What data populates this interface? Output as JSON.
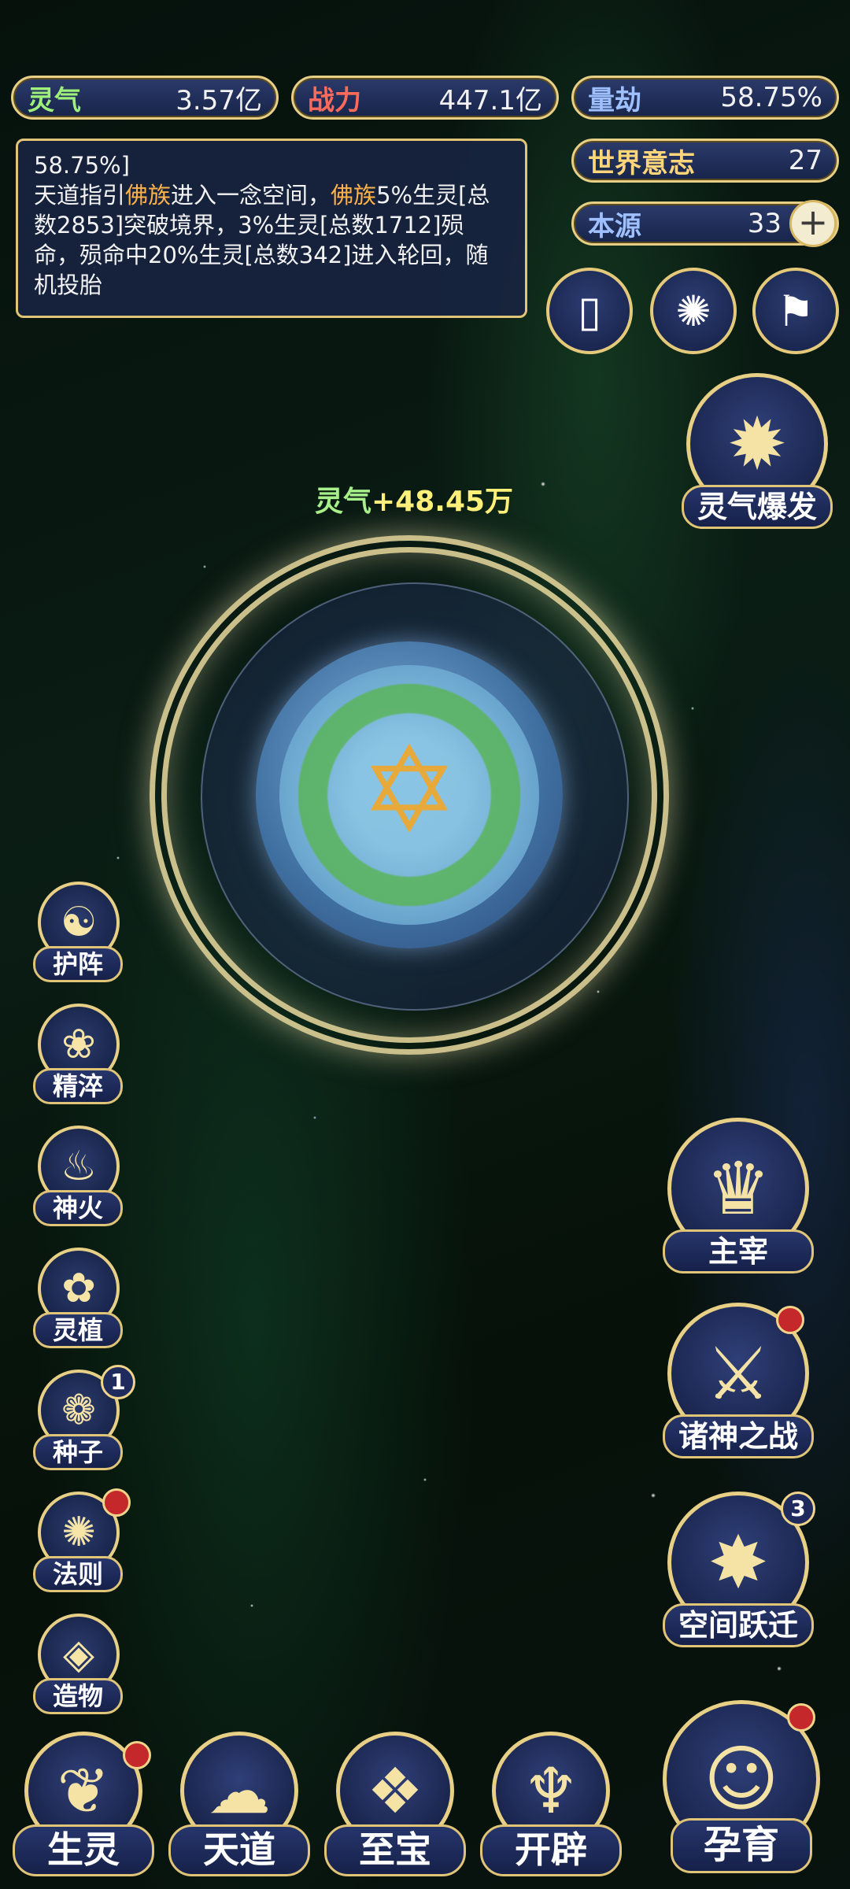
{
  "resources": {
    "lingqi": {
      "label": "灵气",
      "value": "3.57亿"
    },
    "zhanli": {
      "label": "战力",
      "value": "447.1亿"
    },
    "liangjie": {
      "label": "量劫",
      "value": "58.75%"
    },
    "shijieyizhi": {
      "label": "世界意志",
      "value": "27"
    },
    "benyuan": {
      "label": "本源",
      "value": "33",
      "add": "+"
    }
  },
  "message": {
    "line0": "58.75%]",
    "p1": "天道指引",
    "h1": "佛族",
    "p2": "进入一念空间，",
    "h2": "佛族",
    "p3": "5%生灵[总数2853]突破境界，3%生灵[总数1712]殒命，殒命中20%生灵[总数342]进入轮回，随机投胎"
  },
  "gain": {
    "label": "灵气",
    "value": "+48.45万"
  },
  "burst_button": "灵气爆发",
  "left_menu": [
    {
      "label": "护阵",
      "icon": "☯"
    },
    {
      "label": "精淬",
      "icon": "❀"
    },
    {
      "label": "神火",
      "icon": "♨"
    },
    {
      "label": "灵植",
      "icon": "✿"
    },
    {
      "label": "种子",
      "icon": "❁",
      "badge": "1"
    },
    {
      "label": "法则",
      "icon": "✺"
    },
    {
      "label": "造物",
      "icon": "◈"
    }
  ],
  "right_menu": [
    {
      "label": "主宰",
      "icon": "♛"
    },
    {
      "label": "诸神之战",
      "icon": "⚔"
    },
    {
      "label": "空间跃迁",
      "icon": "✸",
      "badge": "3"
    }
  ],
  "bottom_nav": [
    {
      "label": "生灵",
      "icon": "❦"
    },
    {
      "label": "天道",
      "icon": "☁"
    },
    {
      "label": "至宝",
      "icon": "❖"
    },
    {
      "label": "开辟",
      "icon": "♆"
    },
    {
      "label": "孕育",
      "icon": "☺"
    }
  ]
}
